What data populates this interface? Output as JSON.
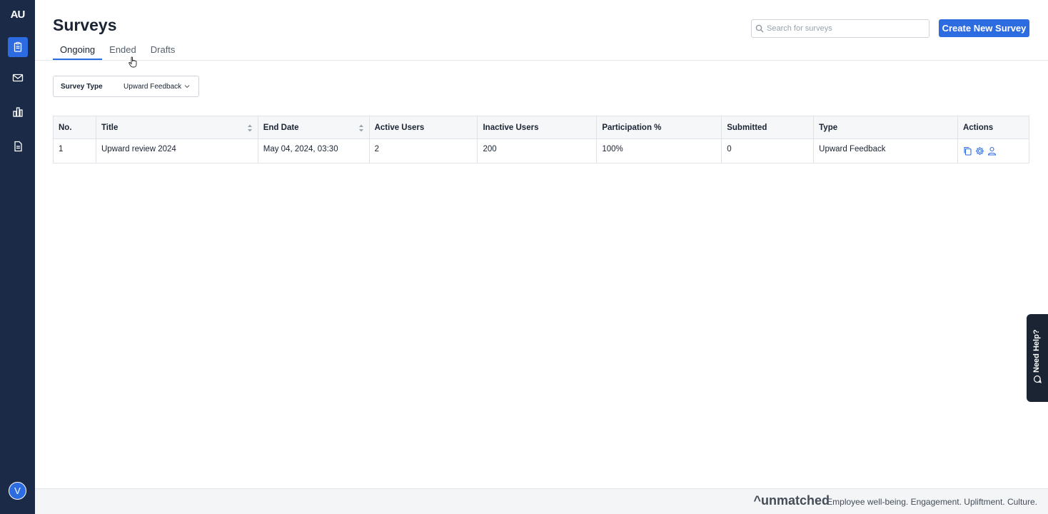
{
  "sidebar": {
    "logo": "AU",
    "items": [
      {
        "name": "surveys",
        "icon": "clipboard-icon",
        "active": true
      },
      {
        "name": "mail",
        "icon": "mail-icon",
        "active": false
      },
      {
        "name": "reports",
        "icon": "bar-chart-icon",
        "active": false
      },
      {
        "name": "documents",
        "icon": "document-icon",
        "active": false
      }
    ],
    "avatar": "V"
  },
  "header": {
    "title": "Surveys",
    "tabs": [
      {
        "label": "Ongoing",
        "active": true
      },
      {
        "label": "Ended",
        "active": false
      },
      {
        "label": "Drafts",
        "active": false
      }
    ],
    "search": {
      "placeholder": "Search for surveys",
      "value": ""
    },
    "create_label": "Create New Survey"
  },
  "filter": {
    "label": "Survey Type",
    "value": "Upward Feedback"
  },
  "table": {
    "columns": [
      "No.",
      "Title",
      "End Date",
      "Active Users",
      "Inactive Users",
      "Participation %",
      "Submitted",
      "Type",
      "Actions"
    ],
    "rows": [
      {
        "no": "1",
        "title": "Upward review 2024",
        "end_date": "May 04, 2024, 03:30",
        "active_users": "2",
        "inactive_users": "200",
        "participation": "100%",
        "submitted": "0",
        "type": "Upward Feedback",
        "actions": [
          "copy-icon",
          "settings-icon",
          "user-icon"
        ]
      }
    ]
  },
  "help": {
    "label": "Need Help?"
  },
  "footer": {
    "brand": "^unmatched",
    "tagline": "Employee well-being. Engagement. Upliftment. Culture."
  },
  "colors": {
    "sidebar_bg": "#1a2a47",
    "accent": "#2d6be0"
  }
}
